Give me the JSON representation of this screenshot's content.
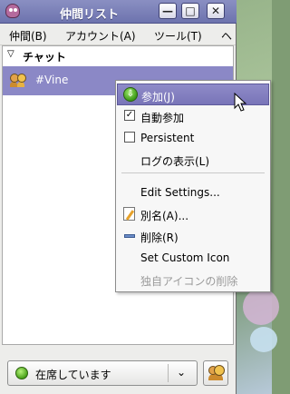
{
  "window": {
    "title": "仲間リスト",
    "buttons": {
      "minimize_glyph": "—",
      "maximize_glyph": "□",
      "close_glyph": "✕"
    }
  },
  "menubar": {
    "items": [
      {
        "label": "仲間(B)"
      },
      {
        "label": "アカウント(A)"
      },
      {
        "label": "ツール(T)"
      },
      {
        "label": "ヘ"
      }
    ]
  },
  "buddy_list": {
    "group": {
      "arrow": "▽",
      "label": "チャット"
    },
    "chat": {
      "name": "#Vine",
      "icon": "chat-group-icon"
    }
  },
  "context_menu": {
    "items": [
      {
        "label": "参加(J)",
        "icon": "join-icon",
        "glyph": "⇩"
      },
      {
        "label": "自動参加",
        "checked": true,
        "check_glyph": "✓"
      },
      {
        "label": "Persistent",
        "checked": false,
        "check_glyph": ""
      },
      {
        "label": "ログの表示(L)"
      },
      {
        "label": "Edit Settings..."
      },
      {
        "label": "別名(A)...",
        "icon": "alias-icon"
      },
      {
        "label": "削除(R)",
        "icon": "remove-icon"
      },
      {
        "label": "Set Custom Icon"
      },
      {
        "label": "独自アイコンの削除",
        "disabled": true
      }
    ]
  },
  "status": {
    "label": "在席しています",
    "icon": "available-status-icon",
    "arrow": "⌄"
  },
  "colors": {
    "selection": "#8b88c6",
    "titlebar": "#7b80b9",
    "menu_highlight": "#7f7bbd"
  }
}
